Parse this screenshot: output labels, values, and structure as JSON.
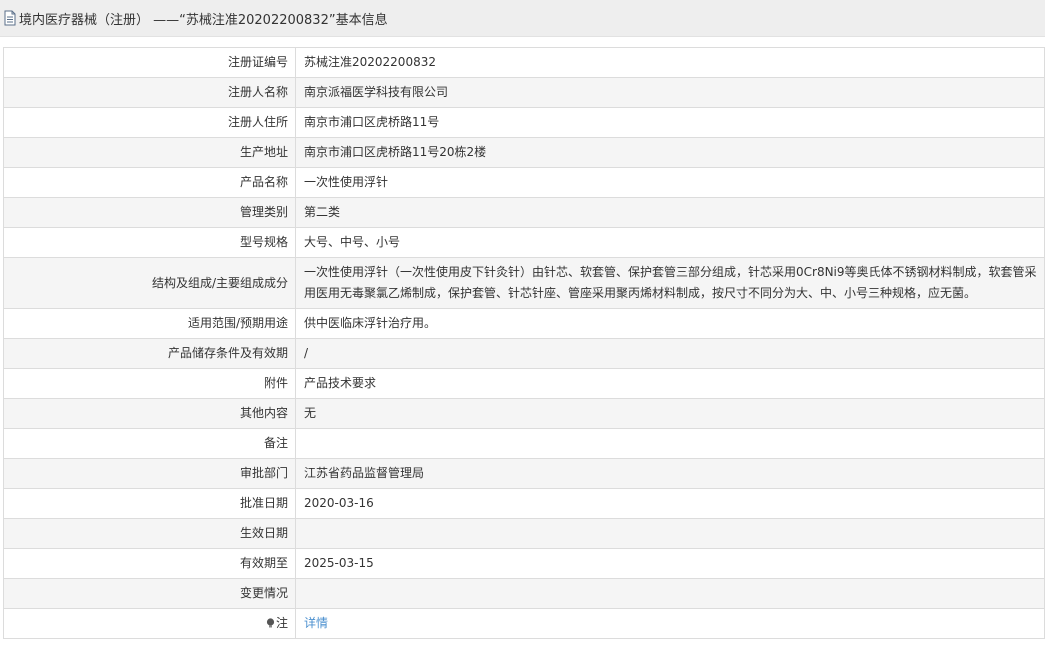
{
  "header": {
    "title": "境内医疗器械（注册） ——“苏械注准20202200832”基本信息"
  },
  "rows": [
    {
      "label": "注册证编号",
      "value": "苏械注准20202200832"
    },
    {
      "label": "注册人名称",
      "value": "南京派福医学科技有限公司"
    },
    {
      "label": "注册人住所",
      "value": "南京市浦口区虎桥路11号"
    },
    {
      "label": "生产地址",
      "value": "南京市浦口区虎桥路11号20栋2楼"
    },
    {
      "label": "产品名称",
      "value": "一次性使用浮针"
    },
    {
      "label": "管理类别",
      "value": "第二类"
    },
    {
      "label": "型号规格",
      "value": "大号、中号、小号"
    },
    {
      "label": "结构及组成/主要组成成分",
      "value": "一次性使用浮针（一次性使用皮下针灸针）由针芯、软套管、保护套管三部分组成，针芯采用0Cr8Ni9等奥氏体不锈钢材料制成，软套管采用医用无毒聚氯乙烯制成，保护套管、针芯针座、管座采用聚丙烯材料制成，按尺寸不同分为大、中、小号三种规格，应无菌。"
    },
    {
      "label": "适用范围/预期用途",
      "value": "供中医临床浮针治疗用。"
    },
    {
      "label": "产品储存条件及有效期",
      "value": "/"
    },
    {
      "label": "附件",
      "value": "产品技术要求"
    },
    {
      "label": "其他内容",
      "value": "无"
    },
    {
      "label": "备注",
      "value": ""
    },
    {
      "label": "审批部门",
      "value": "江苏省药品监督管理局"
    },
    {
      "label": "批准日期",
      "value": "2020-03-16"
    },
    {
      "label": "生效日期",
      "value": ""
    },
    {
      "label": "有效期至",
      "value": "2025-03-15"
    },
    {
      "label": "变更情况",
      "value": ""
    },
    {
      "label": "注",
      "value": "详情"
    }
  ],
  "colors": {
    "link": "#4a8fcf",
    "header_bg": "#eeeeee",
    "row_alt": "#f5f5f5"
  }
}
